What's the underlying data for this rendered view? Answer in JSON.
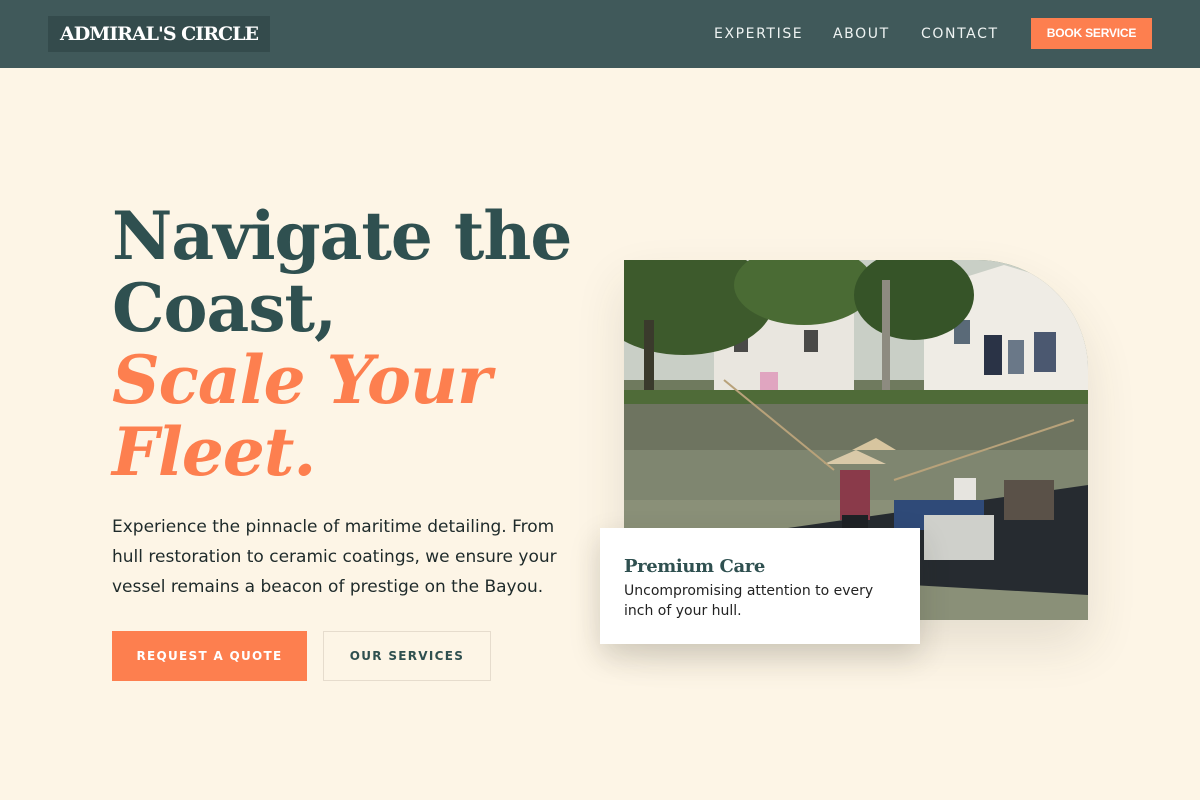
{
  "header": {
    "logo": "ADMIRAL'S CIRCLE",
    "nav": [
      "EXPERTISE",
      "ABOUT",
      "CONTACT"
    ],
    "cta": "BOOK SERVICE"
  },
  "hero": {
    "title_line1": "Navigate the",
    "title_line2": "Coast,",
    "title_line3": "Scale Your",
    "title_line4": "Fleet.",
    "description": "Experience the pinnacle of maritime detailing. From hull restoration to ceramic coatings, we ensure your vessel remains a beacon of prestige on the Bayou.",
    "primary_button": "REQUEST A QUOTE",
    "secondary_button": "OUR SERVICES"
  },
  "feature_card": {
    "title": "Premium Care",
    "description": "Uncompromising attention to every inch of your hull."
  },
  "colors": {
    "header_bg": "#40595a",
    "page_bg": "#fdf5e6",
    "accent": "#fd7f4f",
    "heading": "#2f5050"
  }
}
